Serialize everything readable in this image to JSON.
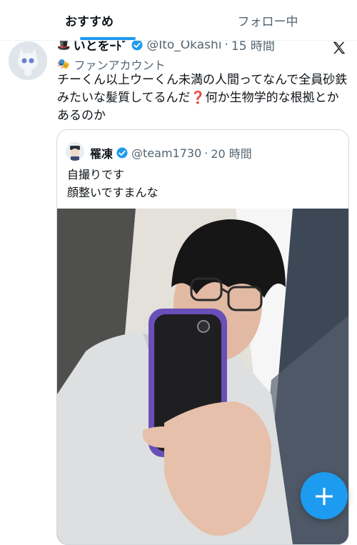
{
  "tabs": [
    {
      "label": "おすすめ",
      "active": true
    },
    {
      "label": "フォロー中",
      "active": false
    }
  ],
  "tweet": {
    "author_name": "いとをｰﾄﾞ",
    "handle": "@Ito_Okashi",
    "separator": "·",
    "time": "15 時間",
    "badge_label": "ファンアカウント",
    "text_main": "チーくん以上ウーくん未満の人間ってなんで全員砂鉄みたいな髪質してるんだ",
    "question_mark": "❓",
    "text_rest": "何か生物学的な根拠とかあるのか"
  },
  "quote": {
    "author_name": "罹凍",
    "handle": "@team1730",
    "separator": "·",
    "time": "20 時間",
    "line1": "自撮りです",
    "line2": "顔整いですまんな"
  },
  "fab": {
    "label": "+"
  },
  "colors": {
    "accent": "#1d9bf0",
    "text": "#0f1419",
    "muted": "#536471",
    "border": "#cfd9de"
  },
  "icons": [
    "x-logo-icon",
    "verified-badge-icon",
    "theater-mask-icon",
    "compose-plus-icon"
  ]
}
